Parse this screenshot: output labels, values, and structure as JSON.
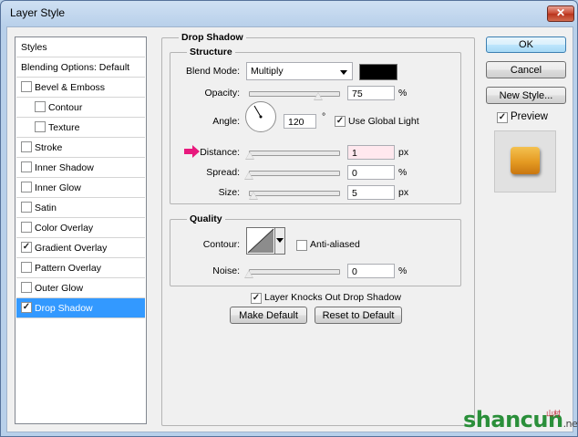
{
  "window": {
    "title": "Layer Style",
    "close_symbol": "✕"
  },
  "styles_list": {
    "header": "Styles",
    "blending": "Blending Options: Default",
    "items": [
      {
        "label": "Bevel & Emboss",
        "checked": false
      },
      {
        "label": "Contour",
        "checked": false
      },
      {
        "label": "Texture",
        "checked": false
      },
      {
        "label": "Stroke",
        "checked": false
      },
      {
        "label": "Inner Shadow",
        "checked": false
      },
      {
        "label": "Inner Glow",
        "checked": false
      },
      {
        "label": "Satin",
        "checked": false
      },
      {
        "label": "Color Overlay",
        "checked": false
      },
      {
        "label": "Gradient Overlay",
        "checked": true
      },
      {
        "label": "Pattern Overlay",
        "checked": false
      },
      {
        "label": "Outer Glow",
        "checked": false
      },
      {
        "label": "Drop Shadow",
        "checked": true,
        "selected": true
      }
    ]
  },
  "drop_shadow": {
    "title": "Drop Shadow",
    "structure": {
      "title": "Structure",
      "blend_mode_label": "Blend Mode:",
      "blend_mode_value": "Multiply",
      "shadow_color": "#000000",
      "opacity_label": "Opacity:",
      "opacity_value": "75",
      "opacity_unit": "%",
      "angle_label": "Angle:",
      "angle_value": "120",
      "angle_unit": "°",
      "use_global_light_label": "Use Global Light",
      "use_global_light_checked": true,
      "distance_label": "Distance:",
      "distance_value": "1",
      "distance_unit": "px",
      "spread_label": "Spread:",
      "spread_value": "0",
      "spread_unit": "%",
      "size_label": "Size:",
      "size_value": "5",
      "size_unit": "px"
    },
    "quality": {
      "title": "Quality",
      "contour_label": "Contour:",
      "anti_aliased_label": "Anti-aliased",
      "anti_aliased_checked": false,
      "noise_label": "Noise:",
      "noise_value": "0",
      "noise_unit": "%"
    },
    "layer_knocks_out_label": "Layer Knocks Out Drop Shadow",
    "layer_knocks_out_checked": true,
    "make_default": "Make Default",
    "reset_to_default": "Reset to Default"
  },
  "buttons": {
    "ok": "OK",
    "cancel": "Cancel",
    "new_style": "New Style...",
    "preview_label": "Preview",
    "preview_checked": true
  },
  "watermark": {
    "text": "shancun",
    "suffix": ".net",
    "small": "山村"
  },
  "colors": {
    "selection": "#3399ff",
    "arrow": "#e8197d",
    "preview_swatch": "#e49a22"
  }
}
